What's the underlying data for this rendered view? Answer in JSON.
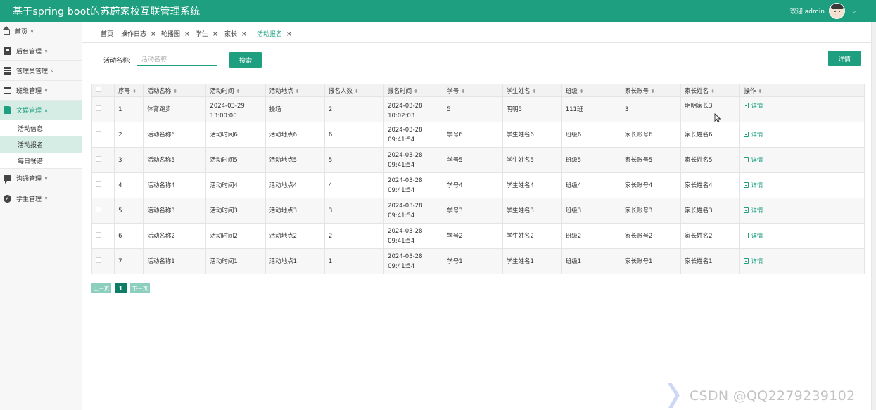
{
  "app": {
    "title": "基于spring boot的苏蔚家校互联管理系统"
  },
  "header": {
    "welcome": "欢迎 admin",
    "caret": "⌵"
  },
  "sidebar": {
    "items": [
      {
        "label": "首页",
        "icon": "home-icon"
      },
      {
        "label": "后台管理",
        "icon": "book-icon"
      },
      {
        "label": "管理员管理",
        "icon": "table-icon"
      },
      {
        "label": "班级管理",
        "icon": "calendar-icon"
      },
      {
        "label": "文娱管理",
        "icon": "flag-icon",
        "expanded": true
      },
      {
        "label": "沟通管理",
        "icon": "chat-icon"
      },
      {
        "label": "学生管理",
        "icon": "gauge-icon"
      }
    ],
    "sub_items": [
      "活动信息",
      "活动报名",
      "每日餐谱"
    ],
    "arrow_down": "∨",
    "arrow_up": "∧"
  },
  "tabs": [
    {
      "label": "首页"
    },
    {
      "label": "操作日志"
    },
    {
      "label": "轮播图"
    },
    {
      "label": "学生"
    },
    {
      "label": "家长"
    },
    {
      "label": "活动报名",
      "active": true
    }
  ],
  "tab_close": "×",
  "search": {
    "label": "活动名称:",
    "placeholder": "活动名称",
    "button": "搜索"
  },
  "detail_button": "详情",
  "table": {
    "sort_symbol": "⬍",
    "columns": [
      "序号",
      "活动名称",
      "活动时间",
      "活动地点",
      "报名人数",
      "报名时间",
      "学号",
      "学生姓名",
      "班级",
      "家长账号",
      "家长姓名",
      "操作"
    ],
    "action_label": "详情",
    "rows": [
      [
        "1",
        "体育跑步",
        "2024-03-29 13:00:00",
        "操场",
        "2",
        "2024-03-28 10:02:03",
        "5",
        "明明5",
        "111班",
        "3",
        "明明家长3"
      ],
      [
        "2",
        "活动名称6",
        "活动时间6",
        "活动地点6",
        "6",
        "2024-03-28 09:41:54",
        "学号6",
        "学生姓名6",
        "班级6",
        "家长账号6",
        "家长姓名6"
      ],
      [
        "3",
        "活动名称5",
        "活动时间5",
        "活动地点5",
        "5",
        "2024-03-28 09:41:54",
        "学号5",
        "学生姓名5",
        "班级5",
        "家长账号5",
        "家长姓名5"
      ],
      [
        "4",
        "活动名称4",
        "活动时间4",
        "活动地点4",
        "4",
        "2024-03-28 09:41:54",
        "学号4",
        "学生姓名4",
        "班级4",
        "家长账号4",
        "家长姓名4"
      ],
      [
        "5",
        "活动名称3",
        "活动时间3",
        "活动地点3",
        "3",
        "2024-03-28 09:41:54",
        "学号3",
        "学生姓名3",
        "班级3",
        "家长账号3",
        "家长姓名3"
      ],
      [
        "6",
        "活动名称2",
        "活动时间2",
        "活动地点2",
        "2",
        "2024-03-28 09:41:54",
        "学号2",
        "学生姓名2",
        "班级2",
        "家长账号2",
        "家长姓名2"
      ],
      [
        "7",
        "活动名称1",
        "活动时间1",
        "活动地点1",
        "1",
        "2024-03-28 09:41:54",
        "学号1",
        "学生姓名1",
        "班级1",
        "家长账号1",
        "家长姓名1"
      ]
    ]
  },
  "pagination": {
    "prev": "上一页",
    "current": "1",
    "next": "下一页"
  },
  "watermark": "CSDN @QQ2279239102",
  "colors": {
    "primary": "#1e9f80",
    "active_bg": "#d6ede6"
  }
}
